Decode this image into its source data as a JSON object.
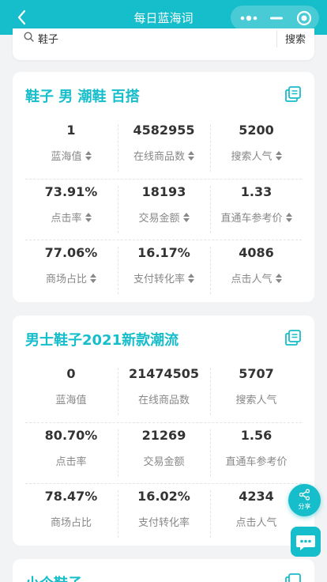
{
  "nav": {
    "title": "每日蓝海词",
    "icons": {
      "back": "back-arrow-icon",
      "more": "more-dots-icon",
      "minimize": "minimize-icon",
      "close": "close-circle-icon"
    }
  },
  "search": {
    "value": "鞋子",
    "button_label": "搜索"
  },
  "colors": {
    "accent": "#16bdca",
    "text": "#333333",
    "label": "#888888",
    "background": "#f2f3f5"
  },
  "cards": [
    {
      "title": "鞋子 男 潮鞋 百搭",
      "rows": [
        [
          {
            "value": "1",
            "label": "蓝海值"
          },
          {
            "value": "4582955",
            "label": "在线商品数"
          },
          {
            "value": "5200",
            "label": "搜索人气"
          }
        ],
        [
          {
            "value": "73.91%",
            "label": "点击率"
          },
          {
            "value": "18193",
            "label": "交易金额"
          },
          {
            "value": "1.33",
            "label": "直通车参考价"
          }
        ],
        [
          {
            "value": "77.06%",
            "label": "商场占比"
          },
          {
            "value": "16.17%",
            "label": "支付转化率"
          },
          {
            "value": "4086",
            "label": "点击人气"
          }
        ]
      ]
    },
    {
      "title": "男士鞋子2021新款潮流",
      "rows": [
        [
          {
            "value": "0",
            "label": "蓝海值"
          },
          {
            "value": "21474505",
            "label": "在线商品数"
          },
          {
            "value": "5707",
            "label": "搜索人气"
          }
        ],
        [
          {
            "value": "80.70%",
            "label": "点击率"
          },
          {
            "value": "21269",
            "label": "交易金额"
          },
          {
            "value": "1.56",
            "label": "直通车参考价"
          }
        ],
        [
          {
            "value": "78.47%",
            "label": "商场占比"
          },
          {
            "value": "16.02%",
            "label": "支付转化率"
          },
          {
            "value": "4234",
            "label": "点击人气"
          }
        ]
      ]
    },
    {
      "title": "小个鞋子"
    }
  ],
  "fab": {
    "share_label": "分享"
  }
}
